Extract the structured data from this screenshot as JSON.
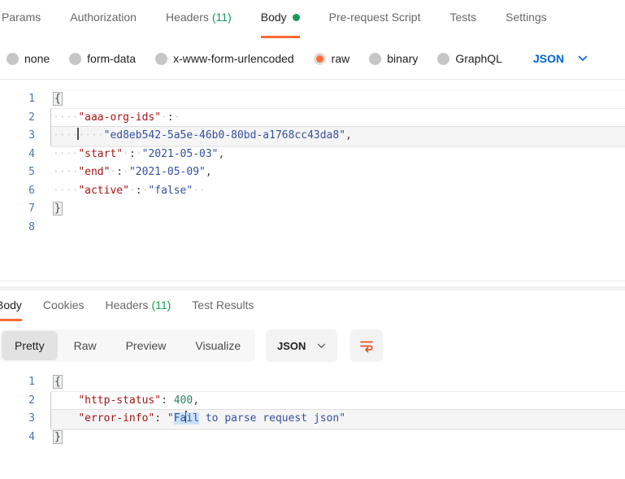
{
  "colors": {
    "accent_orange": "#FF6C37",
    "success_green": "#169B56",
    "link_blue": "#0265D2",
    "key_red": "#A31515",
    "string_blue": "#34519E",
    "number_green": "#2D8565"
  },
  "request": {
    "tabs": [
      {
        "label": "Params"
      },
      {
        "label": "Authorization"
      },
      {
        "label": "Headers",
        "count": "(11)"
      },
      {
        "label": "Body",
        "active": true,
        "dot": true
      },
      {
        "label": "Pre-request Script"
      },
      {
        "label": "Tests"
      },
      {
        "label": "Settings"
      }
    ],
    "body_types": [
      "none",
      "form-data",
      "x-www-form-urlencoded",
      "raw",
      "binary",
      "GraphQL"
    ],
    "selected_body_type": "raw",
    "language": "JSON",
    "editor": {
      "lines": [
        {
          "cls": "top-hair",
          "tokens": [
            {
              "t": "brace",
              "v": "{"
            }
          ]
        },
        {
          "cls": "blk blk-top",
          "tokens": [
            {
              "t": "ws",
              "n": 4
            },
            {
              "t": "key",
              "v": "\"aaa-org-ids\""
            },
            {
              "t": "ws",
              "n": 1
            },
            {
              "t": "punct",
              "v": ":"
            },
            {
              "t": "ws",
              "n": 1
            }
          ]
        },
        {
          "cls": "blk active-line",
          "tokens": [
            {
              "t": "ws",
              "n": 4
            },
            {
              "t": "cursor"
            },
            {
              "t": "ws",
              "n": 4
            },
            {
              "t": "str",
              "v": "\"ed8eb542-5a5e-46b0-80bd-a1768cc43da8\""
            },
            {
              "t": "punct",
              "v": ","
            }
          ]
        },
        {
          "cls": "",
          "tokens": [
            {
              "t": "ws",
              "n": 4
            },
            {
              "t": "key",
              "v": "\"start\""
            },
            {
              "t": "ws",
              "n": 1
            },
            {
              "t": "punct",
              "v": ":"
            },
            {
              "t": "ws",
              "n": 1
            },
            {
              "t": "str",
              "v": "\"2021-05-03\""
            },
            {
              "t": "punct",
              "v": ","
            }
          ]
        },
        {
          "cls": "",
          "tokens": [
            {
              "t": "ws",
              "n": 4
            },
            {
              "t": "key",
              "v": "\"end\""
            },
            {
              "t": "ws",
              "n": 1
            },
            {
              "t": "punct",
              "v": ":"
            },
            {
              "t": "ws",
              "n": 1
            },
            {
              "t": "str",
              "v": "\"2021-05-09\""
            },
            {
              "t": "punct",
              "v": ","
            }
          ]
        },
        {
          "cls": "",
          "tokens": [
            {
              "t": "ws",
              "n": 4
            },
            {
              "t": "key",
              "v": "\"active\""
            },
            {
              "t": "ws",
              "n": 1
            },
            {
              "t": "punct",
              "v": ":"
            },
            {
              "t": "ws",
              "n": 1
            },
            {
              "t": "str",
              "v": "\"false\""
            },
            {
              "t": "ws",
              "n": 2
            }
          ]
        },
        {
          "cls": "",
          "tokens": [
            {
              "t": "brace",
              "v": "}"
            }
          ]
        },
        {
          "cls": "",
          "tokens": []
        }
      ]
    }
  },
  "response": {
    "tabs": [
      {
        "label": "Body",
        "active": true
      },
      {
        "label": "Cookies"
      },
      {
        "label": "Headers",
        "count": "(11)"
      },
      {
        "label": "Test Results"
      }
    ],
    "view_modes": [
      "Pretty",
      "Raw",
      "Preview",
      "Visualize"
    ],
    "selected_view_mode": "Pretty",
    "language": "JSON",
    "editor": {
      "lines": [
        {
          "cls": "",
          "tokens": [
            {
              "t": "brace",
              "v": "{"
            }
          ]
        },
        {
          "cls": "blk blk-top",
          "tokens": [
            {
              "t": "sp",
              "n": 4
            },
            {
              "t": "key",
              "v": "\"http-status\""
            },
            {
              "t": "punct",
              "v": ":"
            },
            {
              "t": "sp",
              "n": 1
            },
            {
              "t": "num",
              "v": "400"
            },
            {
              "t": "punct",
              "v": ","
            }
          ]
        },
        {
          "cls": "blk active-line",
          "tokens": [
            {
              "t": "sp",
              "n": 4
            },
            {
              "t": "key",
              "v": "\"error-info\""
            },
            {
              "t": "punct",
              "v": ":"
            },
            {
              "t": "sp",
              "n": 1
            },
            {
              "t": "str",
              "v": "\""
            },
            {
              "t": "strsel",
              "v": "Fa"
            },
            {
              "t": "cursor"
            },
            {
              "t": "strsel",
              "v": "il"
            },
            {
              "t": "str",
              "v": " to parse request json\""
            }
          ]
        },
        {
          "cls": "",
          "tokens": [
            {
              "t": "brace",
              "v": "}"
            }
          ]
        }
      ]
    }
  }
}
